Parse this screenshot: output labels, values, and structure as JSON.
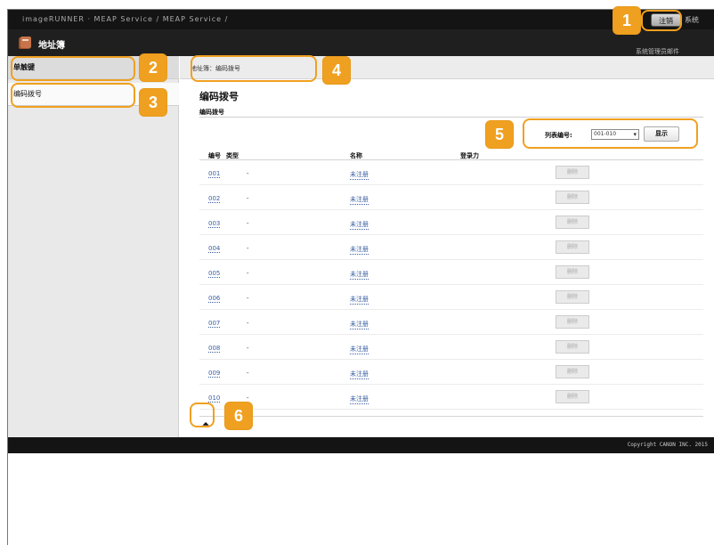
{
  "topbar": {
    "breadcrumb": "imageRUNNER   ·   MEAP Service / MEAP Service /",
    "logout_label": "注销",
    "logout_extra": "系统"
  },
  "header": {
    "title": "地址簿",
    "sub_label": "系统管理员邮件"
  },
  "sidebar": {
    "items": [
      {
        "label": "单触键"
      },
      {
        "label": "编码拨号"
      }
    ]
  },
  "breadcrumb": "地址簿：编码拨号",
  "page": {
    "title": "编码拨号",
    "section": "编码拨号"
  },
  "list_selector": {
    "label": "列表编号:",
    "selected": "001-010",
    "show_button": "显示"
  },
  "table": {
    "headers": [
      "编号",
      "类型",
      "名称",
      "登录力"
    ],
    "rows": [
      {
        "number": "001",
        "type": "-",
        "name": "未注册",
        "action": "删除"
      },
      {
        "number": "002",
        "type": "-",
        "name": "未注册",
        "action": "删除"
      },
      {
        "number": "003",
        "type": "-",
        "name": "未注册",
        "action": "删除"
      },
      {
        "number": "004",
        "type": "-",
        "name": "未注册",
        "action": "删除"
      },
      {
        "number": "005",
        "type": "-",
        "name": "未注册",
        "action": "删除"
      },
      {
        "number": "006",
        "type": "-",
        "name": "未注册",
        "action": "删除"
      },
      {
        "number": "007",
        "type": "-",
        "name": "未注册",
        "action": "删除"
      },
      {
        "number": "008",
        "type": "-",
        "name": "未注册",
        "action": "删除"
      },
      {
        "number": "009",
        "type": "-",
        "name": "未注册",
        "action": "删除"
      },
      {
        "number": "010",
        "type": "-",
        "name": "未注册",
        "action": "删除"
      }
    ]
  },
  "to_top_glyph": "⏶",
  "footer": {
    "copyright": "Copyright CANON INC. 2015"
  },
  "callouts": [
    "1",
    "2",
    "3",
    "4",
    "5",
    "6"
  ],
  "colors": {
    "callout": "#f0a020",
    "link": "#3a5fa0",
    "topbar": "#141414"
  },
  "icons": {
    "header": "address-book-icon",
    "to_top": "back-to-top-icon"
  }
}
